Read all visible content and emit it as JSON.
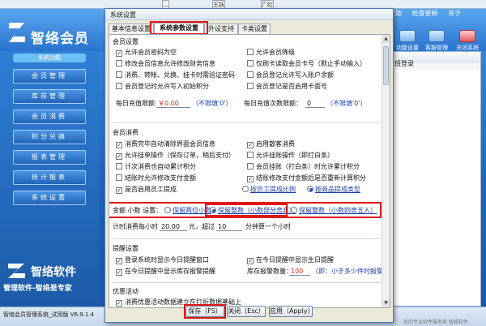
{
  "background_app": {
    "top_tabs": [
      "...",
      "王妖",
      "广红"
    ],
    "top_links": [
      "求助",
      "检查更新",
      "关于"
    ],
    "logo_text": "智络会员",
    "toolbar": [
      {
        "label": "功能设置"
      },
      {
        "label": "客服管理"
      },
      {
        "label": "关闭系统"
      }
    ],
    "nav_title": "系统功能",
    "nav_items": [
      "会员管理",
      "库存管理",
      "会员消费",
      "积分兑换",
      "报表管理",
      "统计报表",
      "系统设置"
    ],
    "brand_name": "智络软件",
    "brand_slogan": "管理软件-智络是专家",
    "login_label": "班登录",
    "status_text": "智络会员管理系统_试用版  V6.9.1.4",
    "status_right": "你的专业软件服务商 智络软件"
  },
  "dialog": {
    "title": "系统设置",
    "tabs": [
      {
        "label": "基本信息设置",
        "active": false
      },
      {
        "label": "系统参数设置",
        "active": true
      },
      {
        "label": "外设支持",
        "active": false
      },
      {
        "label": "卡类设置",
        "active": false
      }
    ],
    "member_settings": {
      "title": "会员设置",
      "left": [
        {
          "label": "允许会员密码为空",
          "checked": true
        },
        {
          "label": "修改会员信息允许修改财务信息",
          "checked": false
        },
        {
          "label": "消费、转帐、兑换、挂卡时需验证密码",
          "checked": false
        },
        {
          "label": "会员登记时允许写入初始积分",
          "checked": false
        }
      ],
      "right": [
        {
          "label": "允许会员降级",
          "checked": false
        },
        {
          "label": "仅刷卡读取会员卡号（默止手动输入）",
          "checked": false
        },
        {
          "label": "会员登记允许写入账户余额",
          "checked": false
        },
        {
          "label": "会员登记是否启用卡面号",
          "checked": false
        }
      ],
      "daily_limit_label": "每日充值限额：",
      "daily_limit_value": "￥0.00",
      "daily_limit_note": "（不限填'0'）",
      "daily_count_label": "每日充值次数限额：",
      "daily_count_value": "0",
      "daily_count_note": "（不限填'0'）"
    },
    "consume_settings": {
      "title": "会员消费",
      "left": [
        {
          "label": "消费完毕自动清除界面会员信息",
          "checked": true
        },
        {
          "label": "允许挂单操作（保存订单，稍后支付）",
          "checked": true
        },
        {
          "label": "计次消费也自动累计积分",
          "checked": false
        },
        {
          "label": "结账时允许修改支付金额",
          "checked": false
        },
        {
          "label": "是否启用员工提成",
          "checked": true
        }
      ],
      "right": [
        {
          "label": "启用散客消费",
          "checked": true
        },
        {
          "label": "允许挂账操作（即打白条）",
          "checked": false
        },
        {
          "label": "会员挂账（打白条）时允许累计积分",
          "checked": false
        },
        {
          "label": "结账修改支付金额后是否重新计算积分",
          "checked": true
        }
      ],
      "commission_radios": [
        {
          "label": "按员工提成比例",
          "checked": false
        },
        {
          "label": "按商品提成类型",
          "checked": true
        }
      ]
    },
    "amount_setting": {
      "label": "金额 小数 设置：",
      "options": [
        {
          "label": "保留两位小数",
          "checked": false
        },
        {
          "label": "保留整数（小数部分舍弃）",
          "checked": true
        },
        {
          "label": "保留整数（小数四舍五入）",
          "checked": false
        }
      ]
    },
    "time_consume": {
      "prefix": "计时消费每小时",
      "price": "20.00",
      "mid": "元，超过",
      "minutes": "10",
      "suffix": "分钟算一个小时"
    },
    "reminder_settings": {
      "title": "提醒设置",
      "left": [
        {
          "label": "登录系统时显示今日提醒窗口",
          "checked": true
        },
        {
          "label": "在今日提醒中显示库存报警提醒",
          "checked": true
        }
      ],
      "right": [
        {
          "label": "在今日提醒中显示生日提醒",
          "checked": true
        }
      ],
      "stock_alarm_label": "库存报警数量：",
      "stock_alarm_value": "100",
      "stock_alarm_note": "（即：小于多少件时报警）"
    },
    "promo_settings": {
      "title": "优惠活动",
      "items": [
        {
          "label": "消费优惠活动数据建立在打折数据基础上",
          "checked": true
        }
      ]
    },
    "buttons": {
      "save": "保存（FS）",
      "close": "关闭（Esc）",
      "apply": "应用（Apply）"
    }
  },
  "colors": {
    "highlight_red": "#e01818",
    "link_blue": "#1a3fb0",
    "value_red": "#d12222"
  }
}
